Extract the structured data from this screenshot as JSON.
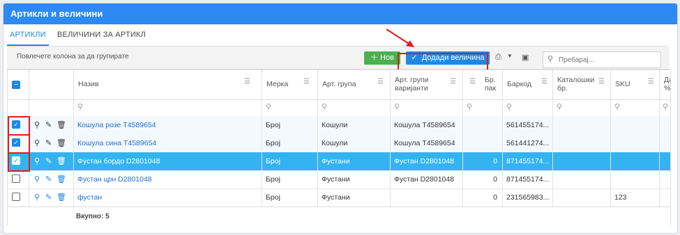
{
  "window": {
    "title": "Артикли и величини"
  },
  "tabs": [
    {
      "label": "АРТИКЛИ",
      "active": true
    },
    {
      "label": "ВЕЛИЧИНИ ЗА АРТИКЛ",
      "active": false
    }
  ],
  "toolbar": {
    "group_hint": "Повлечете колона за да групирате",
    "new_label": "Нов",
    "add_size_label": "Додади величина",
    "search_placeholder": "Пребарај..."
  },
  "grid": {
    "columns": [
      "Назив",
      "Мерка",
      "Арт. група",
      "Арт. групи варијанти",
      "Бр. пак",
      "Баркод",
      "Каталошки бр.",
      "SKU",
      "Да %"
    ],
    "rows": [
      {
        "checked": true,
        "name": "Кошула розе T4589654",
        "unit": "Број",
        "group": "Кошули",
        "variant": "Кошула T4589654",
        "pack": "",
        "barcode": "561455174...",
        "catalog": "",
        "sku": ""
      },
      {
        "checked": true,
        "name": "Кошула сина T4589654",
        "unit": "Број",
        "group": "Кошули",
        "variant": "Кошула T4589654",
        "pack": "",
        "barcode": "561441274...",
        "catalog": "",
        "sku": ""
      },
      {
        "checked": true,
        "name": "Фустан бордо D2801048",
        "unit": "Број",
        "group": "Фустани",
        "variant": "Фустан D2801048",
        "pack": "0",
        "barcode": "871455174...",
        "catalog": "",
        "sku": ""
      },
      {
        "checked": false,
        "name": "Фустан црн D2801048",
        "unit": "Број",
        "group": "Фустани",
        "variant": "Фустан D2801048",
        "pack": "0",
        "barcode": "871455174...",
        "catalog": "",
        "sku": ""
      },
      {
        "checked": false,
        "name": "фустан",
        "unit": "Број",
        "group": "Фустани",
        "variant": "",
        "pack": "0",
        "barcode": "231565983...",
        "catalog": "",
        "sku": "123"
      }
    ],
    "footer_total": "Вкупно: 5"
  },
  "colors": {
    "brand": "#2d8af2",
    "accent": "#1e88e5",
    "new_button": "#4caf50",
    "focused_row": "#33b4f0",
    "highlight": "#e21b1b"
  },
  "icons": [
    "search-icon",
    "edit-pencil-icon",
    "delete-trash-icon",
    "export-icon",
    "chevron-down-icon",
    "column-chooser-icon",
    "filter-icon",
    "check-icon",
    "plus-icon"
  ]
}
